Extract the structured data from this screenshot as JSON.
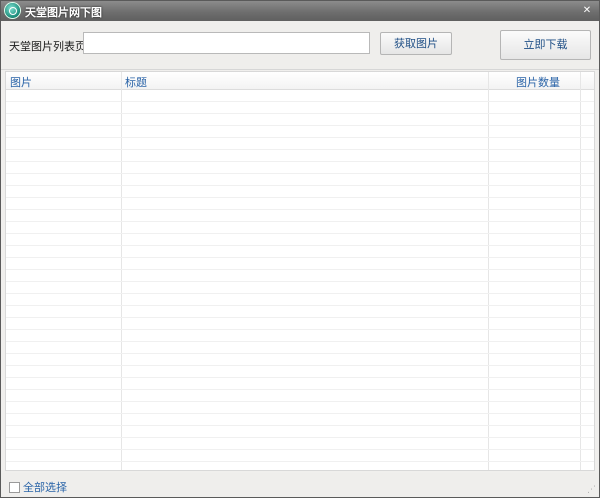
{
  "window": {
    "title": "天堂图片网下图",
    "app_icon": "app-logo-icon",
    "close_icon": "close-icon"
  },
  "toolbar": {
    "url_label": "天堂图片列表页：",
    "url_value": "",
    "url_placeholder": "",
    "fetch_button": "获取图片",
    "download_button": "立即下载"
  },
  "table": {
    "columns": [
      "图片",
      "标题",
      "图片数量"
    ],
    "rows": []
  },
  "footer": {
    "select_all_label": "全部选择",
    "select_all_checked": false
  },
  "colors": {
    "title_bar": "#6e6e6e",
    "link_blue": "#2a64a8",
    "button_text": "#1f4f86",
    "window_bg": "#f0efed"
  }
}
